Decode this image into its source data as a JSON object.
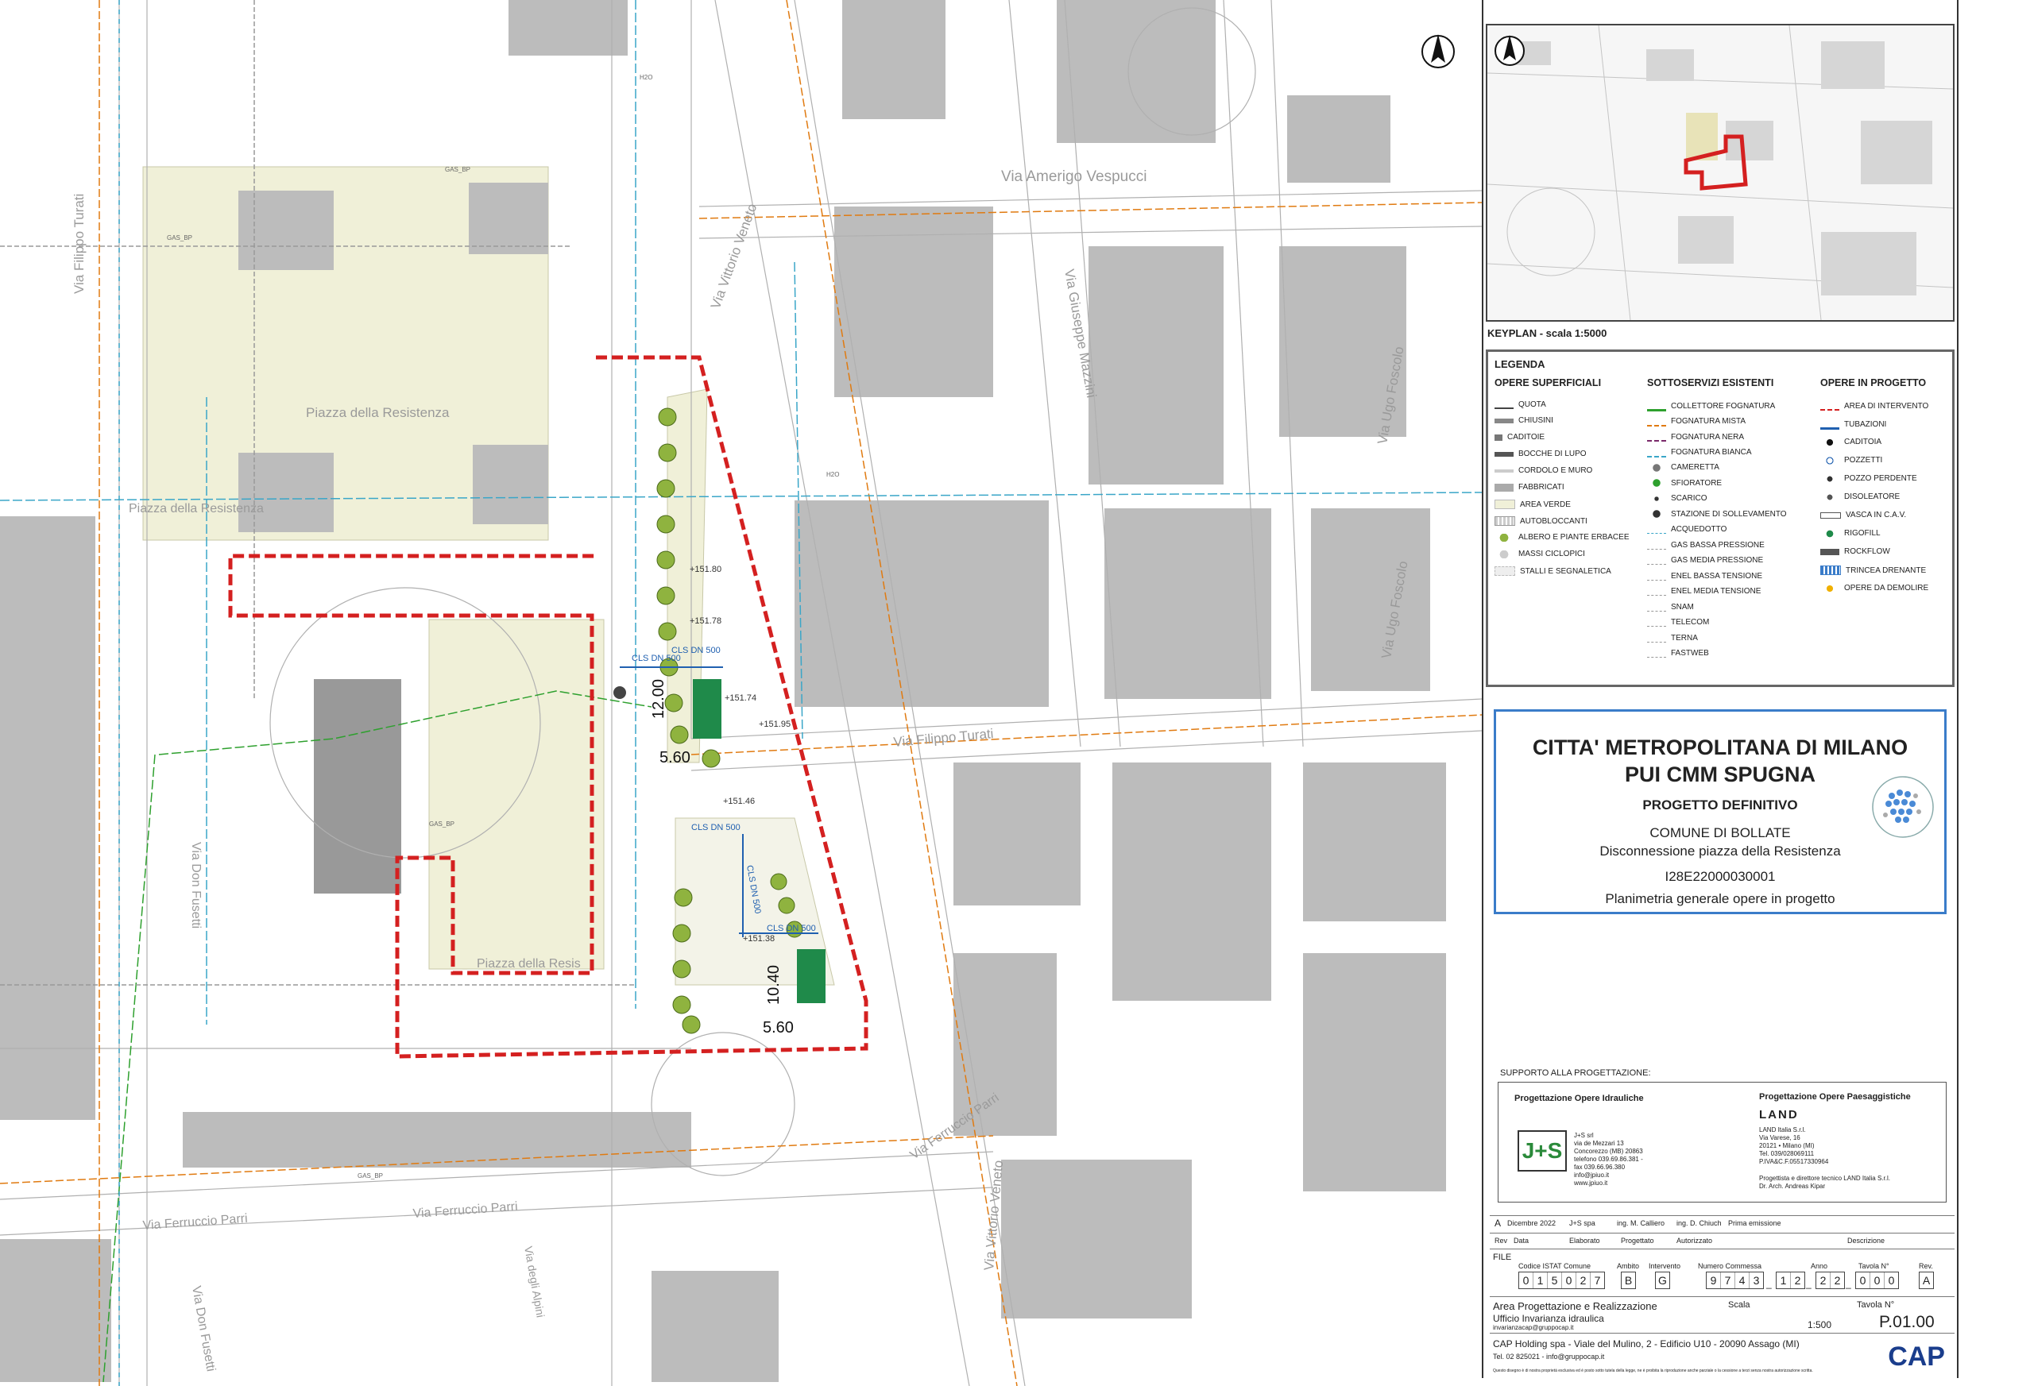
{
  "map": {
    "streets": [
      {
        "id": "via-filippo-turati-w",
        "label": "Via Filippo Turati"
      },
      {
        "id": "via-amerigo-vespucci",
        "label": "Via Amerigo Vespucci"
      },
      {
        "id": "via-vittorio-veneto-n",
        "label": "Via Vittorio Veneto"
      },
      {
        "id": "via-giuseppe-mazzini",
        "label": "Via Giuseppe Mazzini"
      },
      {
        "id": "via-ugo-foscolo-n",
        "label": "Via Ugo Foscolo"
      },
      {
        "id": "via-ugo-foscolo-s",
        "label": "Via Ugo Foscolo"
      },
      {
        "id": "piazza-resistenza-1",
        "label": "Piazza della Resistenza"
      },
      {
        "id": "piazza-resistenza-2",
        "label": "Piazza della Resistenza"
      },
      {
        "id": "piazza-resis",
        "label": "Piazza della Resis"
      },
      {
        "id": "via-filippo-turati-e",
        "label": "Via Filippo Turati"
      },
      {
        "id": "via-don-fusetti-1",
        "label": "Via Don Fusetti"
      },
      {
        "id": "via-don-fusetti-2",
        "label": "Via Don Fusetti"
      },
      {
        "id": "via-ferruccio-parri-1",
        "label": "Via Ferruccio Parri"
      },
      {
        "id": "via-ferruccio-parri-2",
        "label": "Via Ferruccio Parri"
      },
      {
        "id": "via-ferruccio-parri-3",
        "label": "Via Ferruccio Parri"
      },
      {
        "id": "via-vittorio-veneto-s",
        "label": "Via Vittorio Veneto"
      },
      {
        "id": "via-degli-alpini",
        "label": "Via degli Alpini"
      }
    ],
    "dimensions": {
      "d1": "12.00",
      "d2": "5.60",
      "d3": "10.40",
      "d4": "5.60"
    },
    "pipe_labels": {
      "cls_dn500_a": "CLS DN 500",
      "cls_dn500_b": "CLS DN 500",
      "cls_dn500_c": "CLS DN 500",
      "cls_dn500_d": "CLS DN 500",
      "cls_dn500_e": "CLS DN 500"
    },
    "spot_levels": [
      "+151.80",
      "+151.78",
      "+151.74",
      "+151.95",
      "+151.46",
      "+151.38"
    ],
    "gas_label": "GAS_BP",
    "water_label": "H2O",
    "colors": {
      "intervention": "#d42020",
      "green_area": "#f0f0d8",
      "building": "#bcbcbc",
      "street_line": "#b0b0b0",
      "fognatura_mista": "#e07a10",
      "gas": "#999999",
      "fognatura_bianca": "#3aa6c8",
      "collettore": "#2ea02e",
      "tubazioni": "#2060b0",
      "rigofill": "#1f8a4a"
    }
  },
  "keyplan": {
    "label": "KEYPLAN - scala 1:5000"
  },
  "legend": {
    "title": "LEGENDA",
    "col1_title": "OPERE SUPERFICIALI",
    "col1": [
      "QUOTA",
      "CHIUSINI",
      "CADITOIE",
      "BOCCHE DI LUPO",
      "CORDOLO E MURO",
      "FABBRICATI",
      "AREA VERDE",
      "AUTOBLOCCANTI",
      "ALBERO E PIANTE ERBACEE",
      "MASSI CICLOPICI",
      "STALLI E SEGNALETICA"
    ],
    "col2_title": "SOTTOSERVIZI ESISTENTI",
    "col2": [
      "COLLETTORE FOGNATURA",
      "FOGNATURA MISTA",
      "FOGNATURA NERA",
      "FOGNATURA BIANCA",
      "CAMERETTA",
      "SFIORATORE",
      "SCARICO",
      "STAZIONE DI SOLLEVAMENTO",
      "ACQUEDOTTO",
      "GAS BASSA PRESSIONE",
      "GAS MEDIA PRESSIONE",
      "ENEL BASSA TENSIONE",
      "ENEL MEDIA TENSIONE",
      "SNAM",
      "TELECOM",
      "TERNA",
      "FASTWEB"
    ],
    "col3_title": "OPERE IN PROGETTO",
    "col3": [
      "AREA DI INTERVENTO",
      "TUBAZIONI",
      "CADITOIA",
      "POZZETTI",
      "POZZO PERDENTE",
      "DISOLEATORE",
      "VASCA IN C.A.V.",
      "RIGOFILL",
      "ROCKFLOW",
      "TRINCEA DRENANTE",
      "OPERE DA DEMOLIRE"
    ]
  },
  "title": {
    "line1": "CITTA' METROPOLITANA DI MILANO",
    "line2": "PUI CMM SPUGNA",
    "line3": "PROGETTO DEFINITIVO",
    "line4": "COMUNE DI BOLLATE",
    "line5": "Disconnessione piazza della Resistenza",
    "line6": "I28E22000030001",
    "line7": "Planimetria generale opere in progetto"
  },
  "support": {
    "label": "SUPPORTO ALLA PROGETTAZIONE:",
    "idr_title": "Progettazione Opere Idrauliche",
    "idr_text": "J+S srl\nvia de Mezzari 13\nConcorezzo (MB) 20863\ntelefono 039.69.86.381 -\nfax 039.66.96.380\ninfo@jpiuo.it\nwww.jpiuo.it",
    "jps_logo": "J+S",
    "pae_title": "Progettazione Opere Paesaggistiche",
    "land_logo": "LAND",
    "pae_text": "LAND Italia S.r.l.\nVia Varese, 16\n20121 • Milano (MI)\nTel. 039/028069111\nP.IVA&C.F.05517330964",
    "pae_text2": "Progettista e direttore tecnico LAND Italia S.r.l.\nDr. Arch. Andreas Kipar"
  },
  "revisions": {
    "row": {
      "rev": "A",
      "data": "Dicembre 2022",
      "elaborato": "J+S spa",
      "progettato": "ing. M. Calliero",
      "autorizzato": "ing. D. Chiuch",
      "descrizione": "Prima emissione"
    },
    "headers": {
      "rev": "Rev",
      "data": "Data",
      "elaborato": "Elaborato",
      "progettato": "Progettato",
      "autorizzato": "Autorizzato",
      "descrizione": "Descrizione"
    }
  },
  "file": {
    "label": "FILE",
    "h_istat": "Codice ISTAT Comune",
    "h_ambito": "Ambito",
    "h_intervento": "Intervento",
    "h_commessa": "Numero Commessa",
    "h_anno": "Anno",
    "h_tavola": "Tavola N°",
    "h_rev": "Rev.",
    "istat": [
      "0",
      "1",
      "5",
      "0",
      "2",
      "7"
    ],
    "ambito": [
      "B"
    ],
    "intervento": [
      "G"
    ],
    "commessa": [
      "9",
      "7",
      "4",
      "3"
    ],
    "commessa2": [
      "1",
      "2"
    ],
    "anno": [
      "2",
      "2"
    ],
    "tavola": [
      "0",
      "0",
      "0"
    ],
    "rev": [
      "A"
    ]
  },
  "area": {
    "line1": "Area Progettazione e Realizzazione",
    "line2": "Ufficio Invarianza idraulica",
    "line3": "invarianzacap@gruppocap.it",
    "scala_label": "Scala",
    "scala": "1:500",
    "tavola_label": "Tavola N°",
    "tavola": "P.01.00"
  },
  "footer": {
    "line1": "CAP Holding spa - Viale del Mulino, 2 - Edificio U10 - 20090 Assago (MI)",
    "line2": "Tel. 02 825021 - info@gruppocap.it",
    "cap_logo": "CAP",
    "disclaimer": "Questo disegno è di nostra proprietà esclusiva ed è posto sotto tutela della legge, ne è proibita la riproduzione anche parziale o la cessione a terzi senza nostra autorizzazione scritta."
  }
}
